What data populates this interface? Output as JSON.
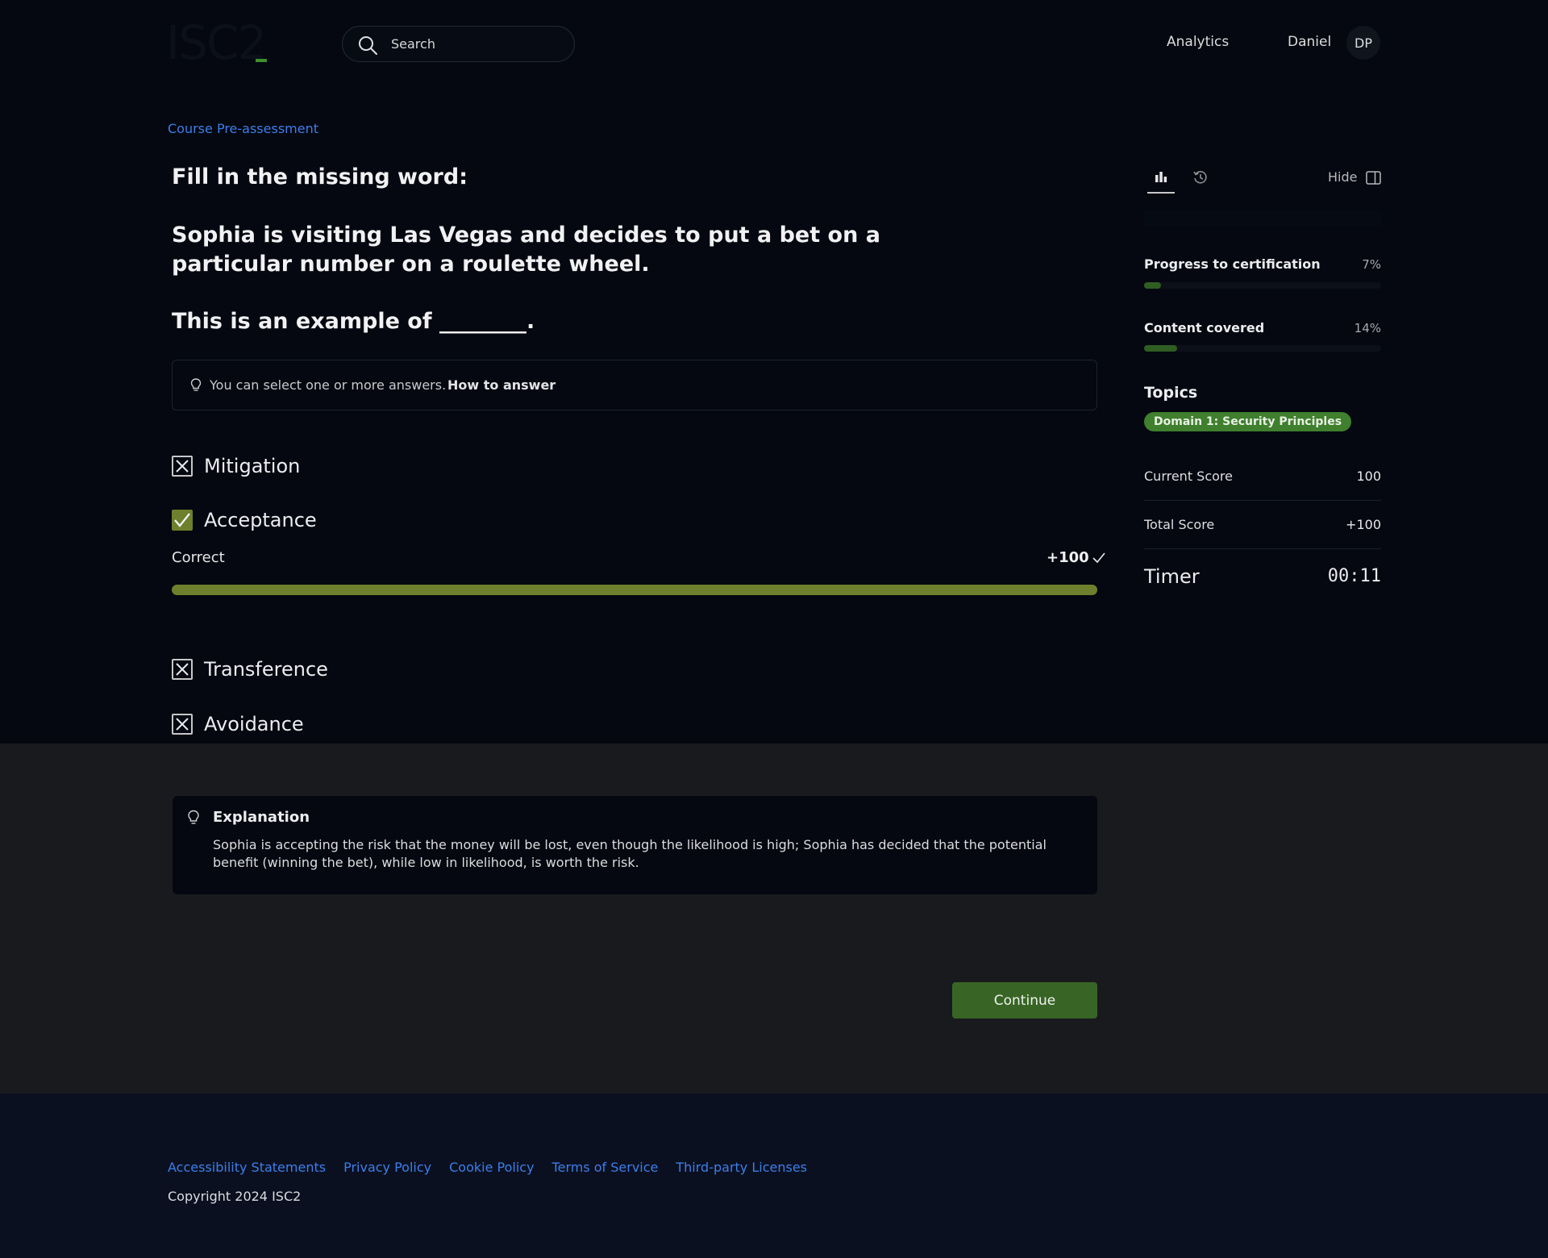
{
  "header": {
    "logo_text": "ISC2",
    "search_placeholder": "Search",
    "nav_analytics": "Analytics",
    "user_name": "Daniel",
    "user_initials": "DP"
  },
  "breadcrumb": "Course Pre-assessment",
  "question": {
    "title": "Fill in the missing word:",
    "body": "Sophia is visiting Las Vegas and decides to put a bet on a particular number on a roulette wheel.",
    "example": "This is an example of ________."
  },
  "hint": {
    "text": "You can select one or more answers.",
    "link": "How to answer"
  },
  "options": [
    {
      "label": "Mitigation",
      "state": "incorrect"
    },
    {
      "label": "Acceptance",
      "state": "correct"
    },
    {
      "label": "Transference",
      "state": "incorrect"
    },
    {
      "label": "Avoidance",
      "state": "incorrect"
    }
  ],
  "result": {
    "label": "Correct",
    "points": "+100",
    "fill_fraction": 1.0
  },
  "sidebar": {
    "hide_label": "Hide",
    "progress_label": "Progress to certification",
    "progress_pct": "7%",
    "progress_fraction": 0.07,
    "content_label": "Content covered",
    "content_pct": "14%",
    "content_fraction": 0.14,
    "topics_title": "Topics",
    "topic": "Domain 1: Security Principles",
    "current_score_label": "Current Score",
    "current_score": "100",
    "total_score_label": "Total Score",
    "total_score": "+100",
    "timer_label": "Timer",
    "timer_value": "00:11"
  },
  "explanation": {
    "title": "Explanation",
    "text": "Sophia is accepting the risk that the money will be lost, even though the likelihood is high; Sophia has decided that the potential benefit (winning the bet), while low in likelihood, is worth the risk."
  },
  "continue_label": "Continue",
  "footer": {
    "links": [
      "Accessibility Statements",
      "Privacy Policy",
      "Cookie Policy",
      "Terms of Service",
      "Third-party Licenses"
    ],
    "copyright": "Copyright 2024 ISC2"
  },
  "colors": {
    "accent_link": "#3c7eea",
    "correct_bar": "#6e7f2d",
    "button_green": "#386525",
    "topic_pill": "#3f7f2e"
  },
  "icons": {
    "search": "search-icon",
    "hint": "lightbulb-icon",
    "stats": "bar-chart-icon",
    "history": "history-icon",
    "hide": "sidebar-panel-icon",
    "incorrect": "x-icon",
    "correct": "check-icon"
  }
}
